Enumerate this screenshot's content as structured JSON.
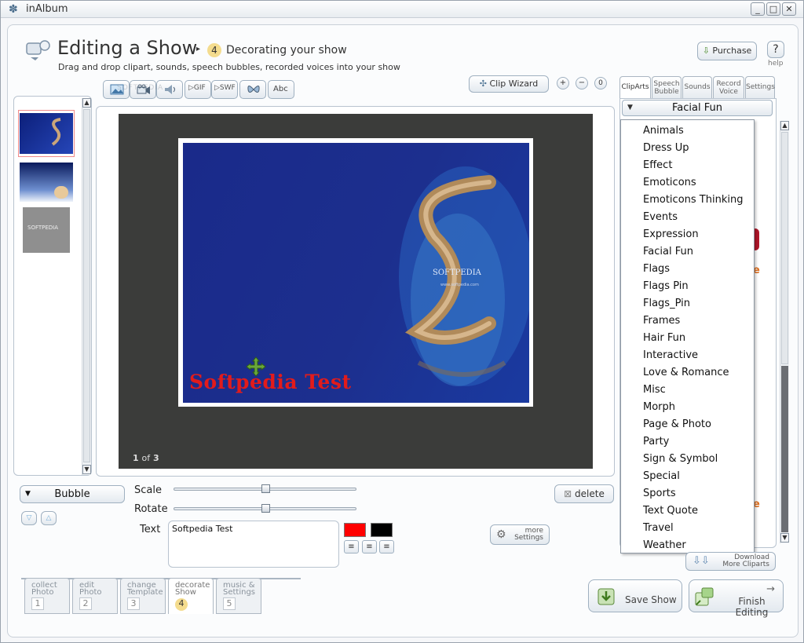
{
  "window": {
    "title": "inAlbum",
    "min": "_",
    "max": "□",
    "close": "✕"
  },
  "header": {
    "title": "Editing a Show",
    "step_num": "4",
    "step_label": "Decorating your show",
    "subtitle": "Drag and drop clipart, sounds, speech bubbles, recorded voices into your show",
    "purchase": "Purchase",
    "help_label": "help",
    "help_icon": "?"
  },
  "toolbar": {
    "gif": "GIF",
    "swf": "SWF",
    "abc": "Abc",
    "clip_wizard": "Clip Wizard",
    "zoom_in": "+",
    "zoom_out": "−",
    "zoom_reset": "0"
  },
  "canvas": {
    "page_indicator_cur": "1",
    "page_indicator_of": "of",
    "page_indicator_total": "3",
    "text_overlay": "Softpedia Test",
    "watermark": "SOFTPEDIA",
    "watermark_url": "www.softpedia.com"
  },
  "thumb_text": "SOFTPEDIA",
  "right_tabs": {
    "cliparts": "ClipArts",
    "speech1": "Speech",
    "speech2": "Bubble",
    "sounds": "Sounds",
    "record1": "Record",
    "record2": "Voice",
    "settings": "Settings"
  },
  "category_select": {
    "value": "Facial Fun"
  },
  "category_options": [
    "Animals",
    "Dress Up",
    "Effect",
    "Emoticons",
    "Emoticons Thinking",
    "Events",
    "Expression",
    "Facial Fun",
    "Flags",
    "Flags Pin",
    "Flags_Pin",
    "Frames",
    "Hair Fun",
    "Interactive",
    "Love & Romance",
    "Misc",
    "Morph",
    "Page & Photo",
    "Party",
    "Sign & Symbol",
    "Special",
    "Sports",
    "Text Quote",
    "Travel",
    "Weather"
  ],
  "download": {
    "line1": "Download",
    "line2": "More Cliparts"
  },
  "props": {
    "type_select": "Bubble",
    "scale_label": "Scale",
    "rotate_label": "Rotate",
    "text_label": "Text",
    "text_value": "Softpedia Test",
    "scale_value": 0.5,
    "rotate_value": 0.5,
    "delete": "delete",
    "more1": "more",
    "more2": "Settings",
    "color_fill": "#ff0000",
    "color_stroke": "#000000"
  },
  "steps": [
    {
      "l1": "collect",
      "l2": "Photo",
      "n": "1"
    },
    {
      "l1": "edit",
      "l2": "Photo",
      "n": "2"
    },
    {
      "l1": "change",
      "l2": "Template",
      "n": "3"
    },
    {
      "l1": "decorate",
      "l2": "Show",
      "n": "4"
    },
    {
      "l1": "music &",
      "l2": "Settings",
      "n": "5"
    }
  ],
  "actions": {
    "save": "Save Show",
    "finish": "Finish Editing"
  },
  "colors": {
    "accent": "#e8a23a",
    "canvas_bg": "#3b3c3a",
    "slide_blue": "#1c2f8e"
  }
}
